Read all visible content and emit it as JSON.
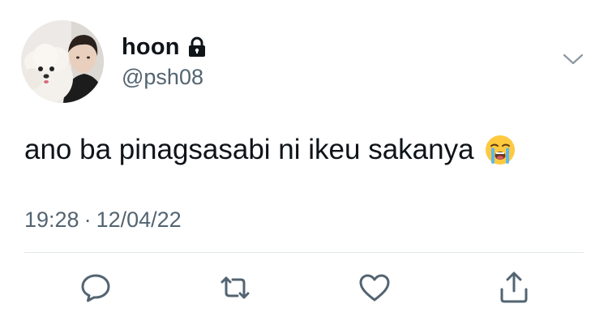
{
  "tweet": {
    "display_name": "hoon",
    "handle": "@psh08",
    "text": "ano ba pinagsasabi ni ikeu sakanya",
    "time": "19:28",
    "separator": "·",
    "date": "12/04/22",
    "emoji": "loudly-crying-face-emoji"
  },
  "icons": {
    "lock": "lock-icon",
    "more": "chevron-down-icon",
    "reply": "reply-icon",
    "retweet": "retweet-icon",
    "like": "heart-icon",
    "share": "share-icon"
  },
  "colors": {
    "text": "#0f1419",
    "secondary": "#536471",
    "icon": "#536471",
    "divider": "#e1e6ea"
  }
}
